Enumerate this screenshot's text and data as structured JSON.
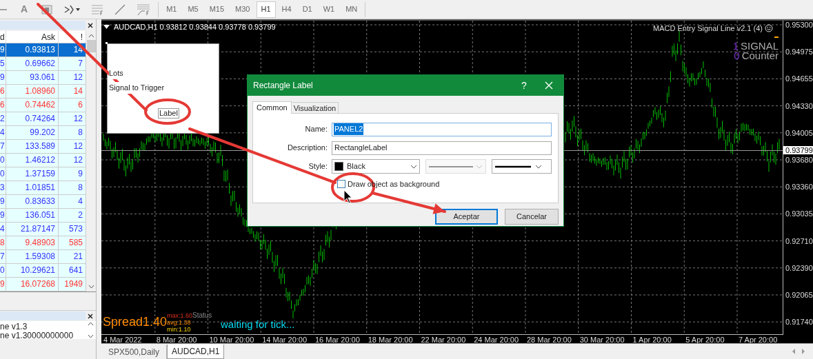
{
  "toolbar": {
    "text_tool_glyph": "A",
    "timeframes": [
      {
        "label": "M1",
        "selected": false
      },
      {
        "label": "M5",
        "selected": false
      },
      {
        "label": "M15",
        "selected": false
      },
      {
        "label": "M30",
        "selected": false
      },
      {
        "label": "H1",
        "selected": true
      },
      {
        "label": "H4",
        "selected": false
      },
      {
        "label": "D1",
        "selected": false
      },
      {
        "label": "W1",
        "selected": false
      },
      {
        "label": "MN",
        "selected": false
      }
    ]
  },
  "market_watch": {
    "columns": [
      "d",
      "Ask",
      "!"
    ],
    "rows": [
      {
        "bid": "9",
        "ask": "0.93813",
        "spread": "14",
        "selected": true
      },
      {
        "bid": "5",
        "ask": "0.69662",
        "spread": "7",
        "color": "#3333ff",
        "selected": false
      },
      {
        "bid": "9",
        "ask": "93.061",
        "spread": "12",
        "color": "#3333ff",
        "selected": false
      },
      {
        "bid": "6",
        "ask": "1.08960",
        "spread": "14",
        "color": "#ff3333",
        "selected": false
      },
      {
        "bid": "6",
        "ask": "0.74462",
        "spread": "6",
        "color": "#ff3333",
        "selected": false
      },
      {
        "bid": "2",
        "ask": "0.74264",
        "spread": "12",
        "color": "#3333ff",
        "selected": false
      },
      {
        "bid": "4",
        "ask": "99.202",
        "spread": "8",
        "color": "#3333ff",
        "selected": false
      },
      {
        "bid": "7",
        "ask": "133.589",
        "spread": "12",
        "color": "#3333ff",
        "selected": false
      },
      {
        "bid": "0",
        "ask": "1.46212",
        "spread": "12",
        "color": "#3333ff",
        "selected": false
      },
      {
        "bid": "0",
        "ask": "1.37159",
        "spread": "9",
        "color": "#3333ff",
        "selected": false
      },
      {
        "bid": "3",
        "ask": "1.01851",
        "spread": "8",
        "color": "#3333ff",
        "selected": false
      },
      {
        "bid": "9",
        "ask": "0.83633",
        "spread": "4",
        "color": "#3333ff",
        "selected": false
      },
      {
        "bid": "9",
        "ask": "136.051",
        "spread": "2",
        "color": "#3333ff",
        "selected": false
      },
      {
        "bid": "4",
        "ask": "21.87147",
        "spread": "573",
        "color": "#3333ff",
        "selected": false
      },
      {
        "bid": "8",
        "ask": "9.48903",
        "spread": "585",
        "color": "#ff3333",
        "selected": false
      },
      {
        "bid": "7",
        "ask": "1.59308",
        "spread": "21",
        "color": "#3333ff",
        "selected": false
      },
      {
        "bid": "0",
        "ask": "10.29621",
        "spread": "641",
        "color": "#3333ff",
        "selected": false
      },
      {
        "bid": "9",
        "ask": "16.07268",
        "spread": "1949",
        "color": "#ff3333",
        "selected": false
      }
    ]
  },
  "journal": {
    "lines": [
      "ne v1.3",
      "ne v1.30000000000"
    ]
  },
  "chart": {
    "symbol": "AUDCAD,H1",
    "prices": [
      "0.93812",
      "0.93844",
      "0.93778",
      "0.93799"
    ],
    "indicator_title": "MACD Entry Signal Line v2.1 (4)",
    "signal": {
      "value": "1",
      "label": "SIGNAL"
    },
    "counter": {
      "value": "0",
      "label": "Counter"
    },
    "price_axis": [
      "0.95300",
      "0.94975",
      "0.94655",
      "0.94330",
      "0.94005",
      "0.93680",
      "0.93360",
      "0.93035",
      "0.92710",
      "0.92390",
      "0.92065",
      "0.91740"
    ],
    "current_price": "0.93799",
    "time_axis": [
      "4 Mar 2022",
      "8 Mar 20:00",
      "10 Mar 20:00",
      "14 Mar 20:00",
      "16 Mar 20:00",
      "18 Mar 20:00",
      "22 Mar 20:00",
      "24 Mar 20:00",
      "28 Mar 20:00",
      "30 Mar 20:00",
      "1 Apr 20:00",
      "5 Apr 20:00",
      "7 Apr 20:00"
    ],
    "spread": {
      "label": "Spread1.40",
      "max": "max:1.60",
      "avg": "avg:1.38",
      "min": "min:1.10"
    },
    "status_label": "Status",
    "status": "waiting for tick...",
    "panel": {
      "lines": [
        "Lots",
        "Signal to Trigger"
      ],
      "label": "Label"
    }
  },
  "dialog": {
    "title": "Rectangle Label",
    "help": "?",
    "tabs": [
      {
        "label": "Common",
        "selected": true
      },
      {
        "label": "Visualization",
        "selected": false
      }
    ],
    "name_label": "Name:",
    "name": "PANEL2",
    "description_label": "Description:",
    "description": "RectangleLabel",
    "style_label": "Style:",
    "color_name": "Black",
    "background_checkbox": {
      "label": "Draw object as background",
      "checked": false
    },
    "buttons": [
      {
        "label": "Aceptar",
        "default": true
      },
      {
        "label": "Cancelar",
        "default": false
      }
    ]
  },
  "chart_tabs": [
    {
      "label": "SPX500,Daily",
      "selected": false
    },
    {
      "label": "AUDCAD,H1",
      "selected": true
    }
  ]
}
